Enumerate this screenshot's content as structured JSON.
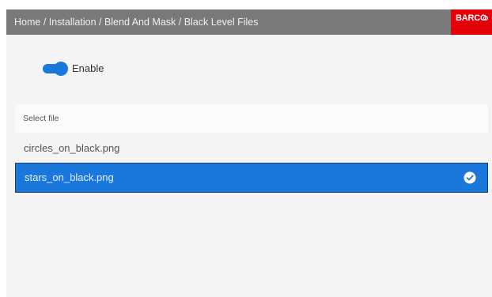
{
  "header": {
    "breadcrumb": "Home / Installation / Blend And Mask / Black Level Files",
    "logo_text": "BARCO",
    "logo_color": "#e4000b"
  },
  "enable_toggle": {
    "label": "Enable",
    "on": true,
    "accent_color": "#1a78dc"
  },
  "file_list": {
    "header_label": "Select file",
    "items": [
      {
        "name": "circles_on_black.png",
        "selected": false
      },
      {
        "name": "stars_on_black.png",
        "selected": true,
        "icon": "check-circle-icon"
      }
    ]
  }
}
